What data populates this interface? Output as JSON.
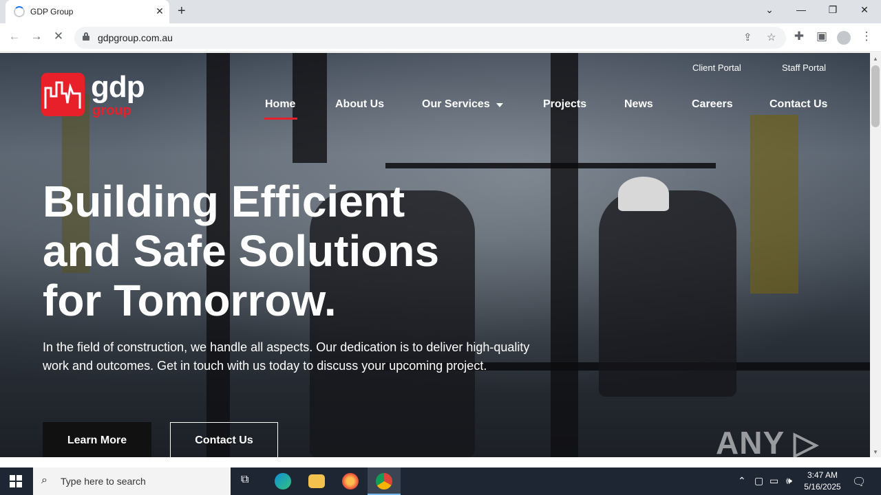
{
  "browser": {
    "tab_title": "GDP Group",
    "tab_close": "✕",
    "new_tab": "+",
    "url": "gdpgroup.com.au",
    "window_controls": {
      "chevron": "⌄",
      "minimize": "—",
      "restore": "❐",
      "close": "✕"
    }
  },
  "site": {
    "logo_text": "gdp",
    "logo_subtext": "group",
    "utility_links": [
      "Client Portal",
      "Staff Portal"
    ],
    "nav": [
      "Home",
      "About Us",
      "Our Services",
      "Projects",
      "News",
      "Careers",
      "Contact Us"
    ],
    "hero_title_lines": [
      "Building Efficient",
      "and Safe Solutions",
      "for Tomorrow."
    ],
    "hero_text": "In the field of construction, we handle all aspects. Our dedication is to deliver high-quality work and outcomes. Get in touch with us today to discuss your upcoming project.",
    "buttons": {
      "learn_more": "Learn More",
      "contact_us": "Contact Us"
    },
    "watermark": "ANY ▷ RUN",
    "brand_color": "#e8202a"
  },
  "taskbar": {
    "search_placeholder": "Type here to search",
    "time": "3:47 AM",
    "date": "5/16/2025",
    "icons": [
      "start-icon",
      "task-view-icon",
      "edge-icon",
      "file-explorer-icon",
      "firefox-icon",
      "chrome-icon"
    ]
  }
}
